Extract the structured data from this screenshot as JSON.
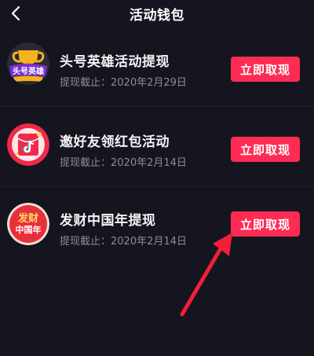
{
  "header": {
    "back_icon": "chevron-left-icon",
    "title": "活动钱包"
  },
  "colors": {
    "background": "#15151f",
    "button": "#fe2c55",
    "subtitle": "#8d8d99",
    "arrow": "#f21f37"
  },
  "activities": [
    {
      "icon": "trophy-hero-icon",
      "icon_text": "头号英雄",
      "title": "头号英雄活动提现",
      "deadline": "提现截止：2020年2月29日",
      "button_label": "立即取现"
    },
    {
      "icon": "tiktok-red-envelope-icon",
      "title": "邀好友领红包活动",
      "deadline": "提现截止：2020年2月14日",
      "button_label": "立即取现"
    },
    {
      "icon": "chinese-new-year-fortune-icon",
      "icon_text_top": "发财",
      "icon_text_bottom": "中国年",
      "title": "发财中国年提现",
      "deadline": "提现截止：2020年2月14日",
      "button_label": "立即取现"
    }
  ],
  "annotation": {
    "icon": "red-arrow-icon"
  }
}
